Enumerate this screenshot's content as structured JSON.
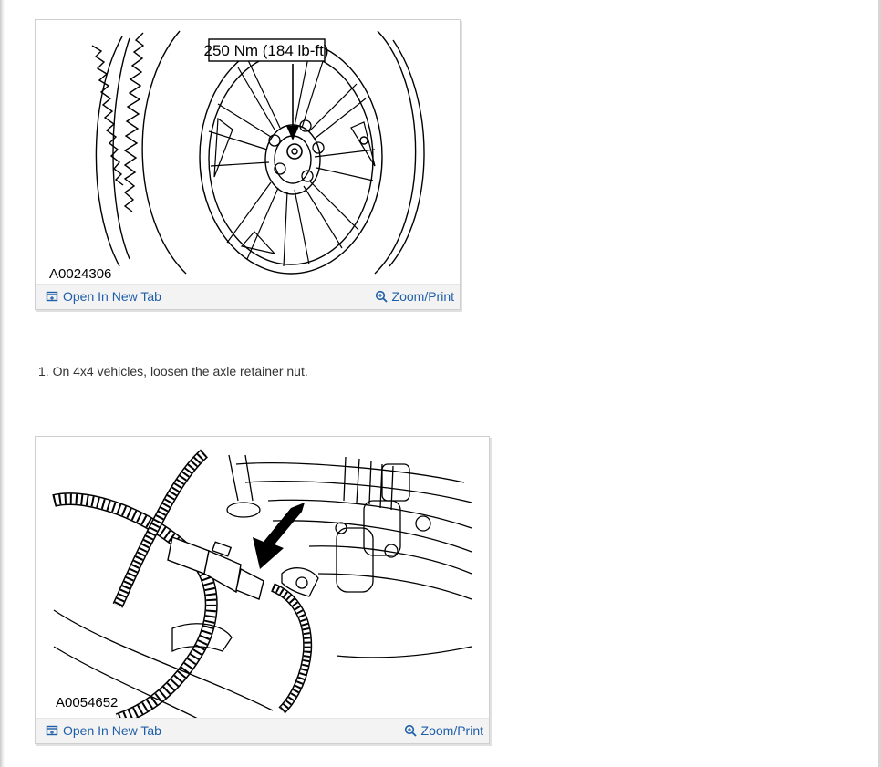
{
  "figures": [
    {
      "id": "A0024306",
      "callout": "250 Nm (184 lb-ft)",
      "open_label": "Open In New Tab",
      "zoom_label": "Zoom/Print",
      "open_icon": "open-new-tab-icon",
      "zoom_icon": "zoom-magnifier-icon"
    },
    {
      "id": "A0054652",
      "open_label": "Open In New Tab",
      "zoom_label": "Zoom/Print",
      "open_icon": "open-new-tab-icon",
      "zoom_icon": "zoom-magnifier-icon"
    }
  ],
  "steps": [
    {
      "text": "1. On 4x4 vehicles, loosen the axle retainer nut."
    }
  ],
  "colors": {
    "link": "#1f5ea8",
    "body_text": "#333333",
    "bar_background": "#f3f3f3"
  }
}
